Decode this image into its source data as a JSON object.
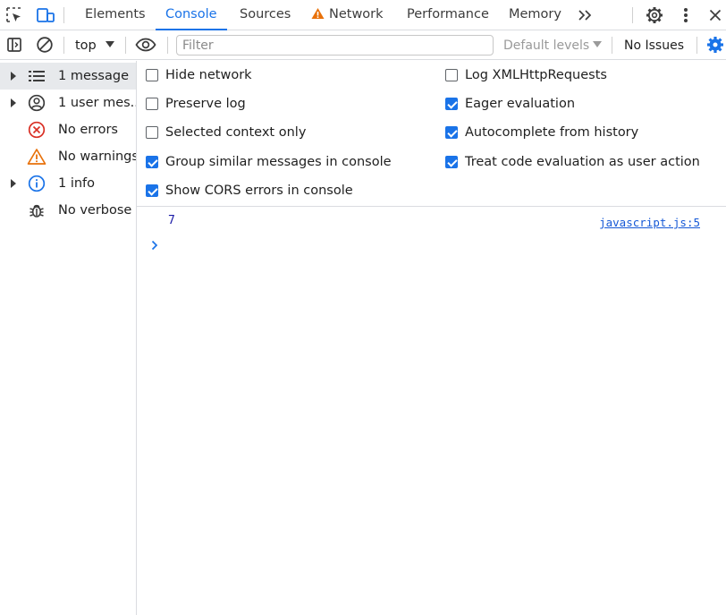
{
  "tabs": [
    {
      "label": "Elements"
    },
    {
      "label": "Console",
      "active": true
    },
    {
      "label": "Sources"
    },
    {
      "label": "Network",
      "warning": true
    },
    {
      "label": "Performance"
    },
    {
      "label": "Memory"
    }
  ],
  "toolbar": {
    "context": "top",
    "filter_placeholder": "Filter",
    "levels": "Default levels",
    "issues": "No Issues"
  },
  "sidebar": {
    "items": [
      {
        "label": "1 message",
        "icon": "list-icon",
        "expandable": true,
        "selected": true
      },
      {
        "label": "1 user mes...",
        "icon": "user-icon",
        "expandable": true
      },
      {
        "label": "No errors",
        "icon": "error-icon",
        "expandable": false
      },
      {
        "label": "No warnings",
        "icon": "warning-icon",
        "expandable": false
      },
      {
        "label": "1 info",
        "icon": "info-icon",
        "expandable": true
      },
      {
        "label": "No verbose",
        "icon": "bug-icon",
        "expandable": false
      }
    ]
  },
  "settings": {
    "left": [
      {
        "label": "Hide network",
        "checked": false
      },
      {
        "label": "Preserve log",
        "checked": false
      },
      {
        "label": "Selected context only",
        "checked": false
      },
      {
        "label": "Group similar messages in console",
        "checked": true
      },
      {
        "label": "Show CORS errors in console",
        "checked": true
      }
    ],
    "right": [
      {
        "label": "Log XMLHttpRequests",
        "checked": false
      },
      {
        "label": "Eager evaluation",
        "checked": true
      },
      {
        "label": "Autocomplete from history",
        "checked": true
      },
      {
        "label": "Treat code evaluation as user action",
        "checked": true
      }
    ]
  },
  "console": {
    "messages": [
      {
        "value": "7",
        "source": "javascript.js:5"
      }
    ]
  },
  "colors": {
    "accent": "#1a73e8",
    "warning": "#e8710a",
    "error": "#d93025"
  }
}
